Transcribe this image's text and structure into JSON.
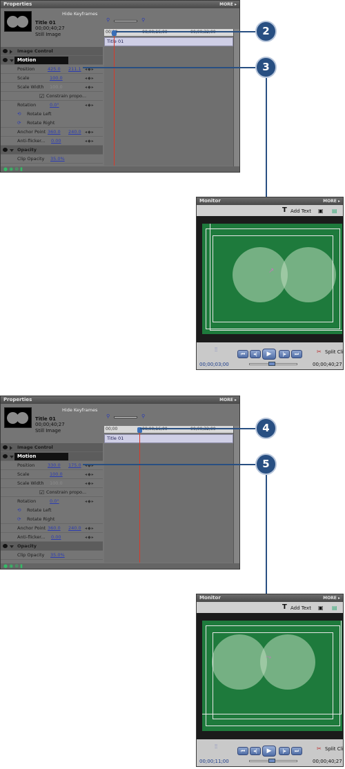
{
  "properties": {
    "title": "Properties",
    "more": "MORE ▸",
    "hide_keyframes": "Hide Keyframes",
    "clip_name": "Title 01",
    "duration": "00;00;40;27",
    "clip_type": "Still Image",
    "sections": {
      "image_control": "Image Control",
      "motion": "Motion",
      "opacity": "Opacity"
    },
    "labels": {
      "position": "Position",
      "scale": "Scale",
      "scale_width": "Scale Width",
      "constrain": "Constrain propo...",
      "rotation": "Rotation",
      "rotate_left": "Rotate Left",
      "rotate_right": "Rotate Right",
      "anchor_point": "Anchor Point",
      "anti_flicker": "Anti-flicker...",
      "clip_opacity": "Clip Opacity"
    },
    "timeline_clip": "Title 01"
  },
  "step1": {
    "ruler": {
      "t0": "00;00",
      "t1": "00;00;16;00",
      "t2": "00;00;32;00"
    },
    "position_x": "425.0",
    "position_y": "211.1",
    "scale": "100.0",
    "scale_width": "100.0",
    "rotation": "0.0°",
    "anchor_x": "360.0",
    "anchor_y": "240.0",
    "anti_flicker": "0.00",
    "clip_opacity": "35.0%",
    "callout_a": "2",
    "callout_b": "3",
    "monitor": {
      "title": "Monitor",
      "more": "MORE ▸",
      "add_text": "Add Text",
      "current_time": "00;00;03;00",
      "duration": "00;00;40;27",
      "split_clip": "Split Clip"
    }
  },
  "step2": {
    "ruler": {
      "t0": "00;00",
      "t1": "00;00;16;00",
      "t2": "00;00;32;00"
    },
    "position_x": "330.0",
    "position_y": "175.0",
    "scale": "100.0",
    "scale_width": "100.0",
    "rotation": "0.0°",
    "anchor_x": "360.0",
    "anchor_y": "240.0",
    "anti_flicker": "0.00",
    "clip_opacity": "35.0%",
    "callout_a": "4",
    "callout_b": "5",
    "monitor": {
      "title": "Monitor",
      "more": "MORE ▸",
      "add_text": "Add Text",
      "current_time": "00;00;11;00",
      "duration": "00;00;40;27",
      "split_clip": "Split Clip"
    }
  },
  "colors": {
    "callout": "#284f82",
    "screen_green": "#1e7a3c",
    "link_blue": "#2a3bb3",
    "cti_red": "#d83a2a"
  }
}
